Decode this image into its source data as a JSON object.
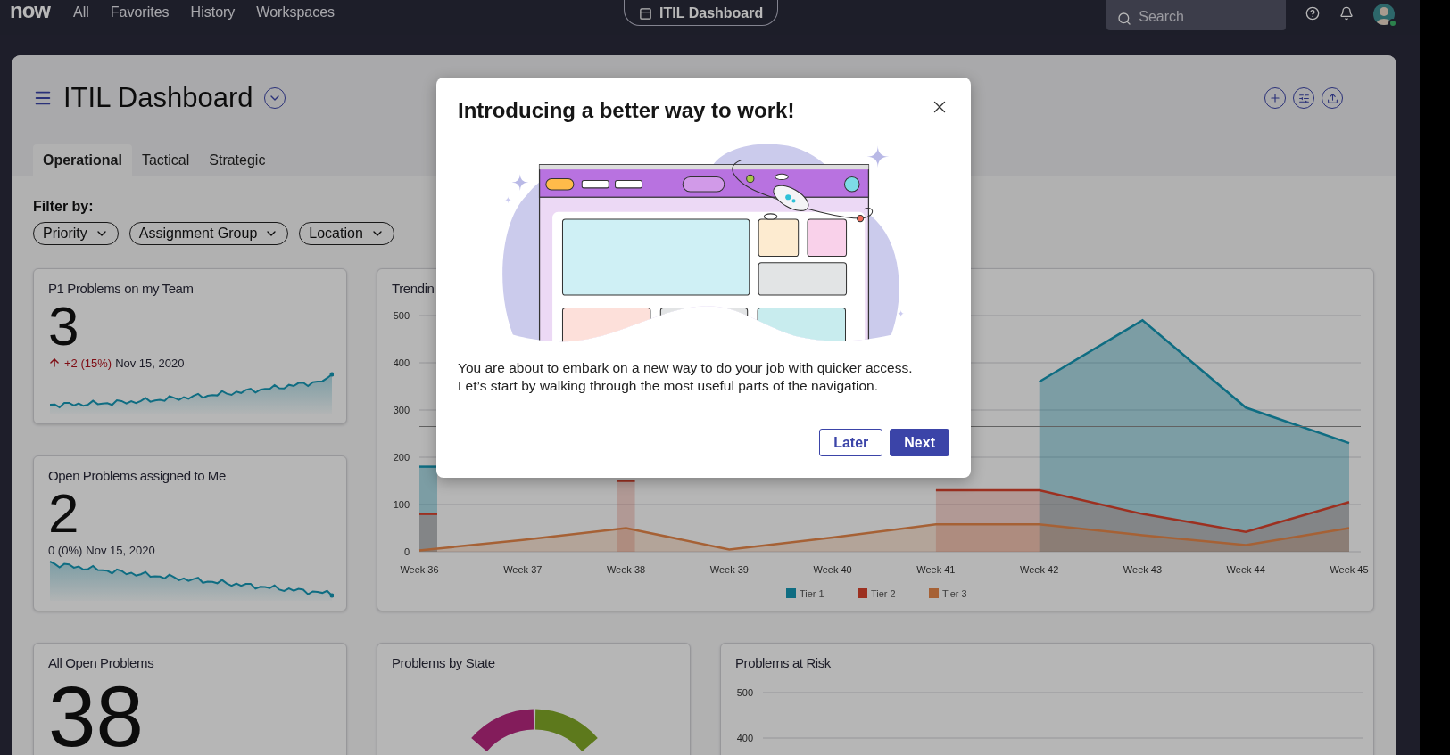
{
  "top_bar": {
    "logo": "now",
    "nav": [
      "All",
      "Favorites",
      "History",
      "Workspaces"
    ],
    "current_page": "ITIL Dashboard",
    "search": {
      "placeholder": "Search"
    },
    "user": {
      "online": true
    }
  },
  "dashboard": {
    "title": "ITIL Dashboard",
    "tabs": [
      {
        "label": "Operational",
        "selected": true
      },
      {
        "label": "Tactical",
        "selected": false
      },
      {
        "label": "Strategic",
        "selected": false
      }
    ],
    "filter_label": "Filter by:",
    "filters": [
      "Priority",
      "Assignment Group",
      "Location"
    ]
  },
  "cards": [
    {
      "kind": "metric",
      "title": "P1 Problems on my Team",
      "value": "3",
      "change": "+2 (15%)",
      "trend_up": true,
      "date": "Nov 15, 2020",
      "sparkline_rising": true
    },
    {
      "kind": "line_chart",
      "title": "Trendin",
      "chart_data": {
        "type": "area",
        "categories": [
          "Week 36",
          "Week 37",
          "Week 38",
          "Week 39",
          "Week 40",
          "Week 41",
          "Week 42",
          "Week 43",
          "Week 44",
          "Week 45"
        ],
        "series": [
          {
            "name": "Tier 1",
            "color": "#1597b5",
            "values": [
              180,
              null,
              null,
              null,
              null,
              null,
              360,
              490,
              305,
              230
            ]
          },
          {
            "name": "Tier 2",
            "color": "#d9432d",
            "values": [
              80,
              null,
              150,
              null,
              null,
              130,
              130,
              80,
              42,
              105
            ]
          },
          {
            "name": "Tier 3",
            "color": "#e6874a",
            "values": [
              3,
              25,
              50,
              5,
              30,
              58,
              58,
              35,
              14,
              50
            ]
          }
        ],
        "ylim": [
          0,
          500
        ],
        "yticks": [
          0,
          100,
          200,
          300,
          400,
          500
        ],
        "grid": true,
        "legend": "bottom"
      }
    },
    {
      "kind": "metric",
      "title": "Open Problems assigned to Me",
      "value": "2",
      "change": "0 (0%)",
      "trend_up": false,
      "date": "Nov 15, 2020",
      "sparkline_rising": false
    },
    {
      "kind": "metric",
      "title": "All Open Problems",
      "value": "38"
    },
    {
      "kind": "donut",
      "title": "Problems by State"
    },
    {
      "kind": "axis_only",
      "title": "Problems at Risk",
      "y_labels": [
        "500",
        "400"
      ]
    }
  ],
  "dialog": {
    "title": "Introducing a better way to work!",
    "body": "You are about to embark on a new way to do your job with quicker access. Let’s start by walking through the most useful parts of the navigation.",
    "buttons": [
      {
        "label": "Later",
        "kind": "secondary"
      },
      {
        "label": "Next",
        "kind": "primary"
      }
    ]
  }
}
